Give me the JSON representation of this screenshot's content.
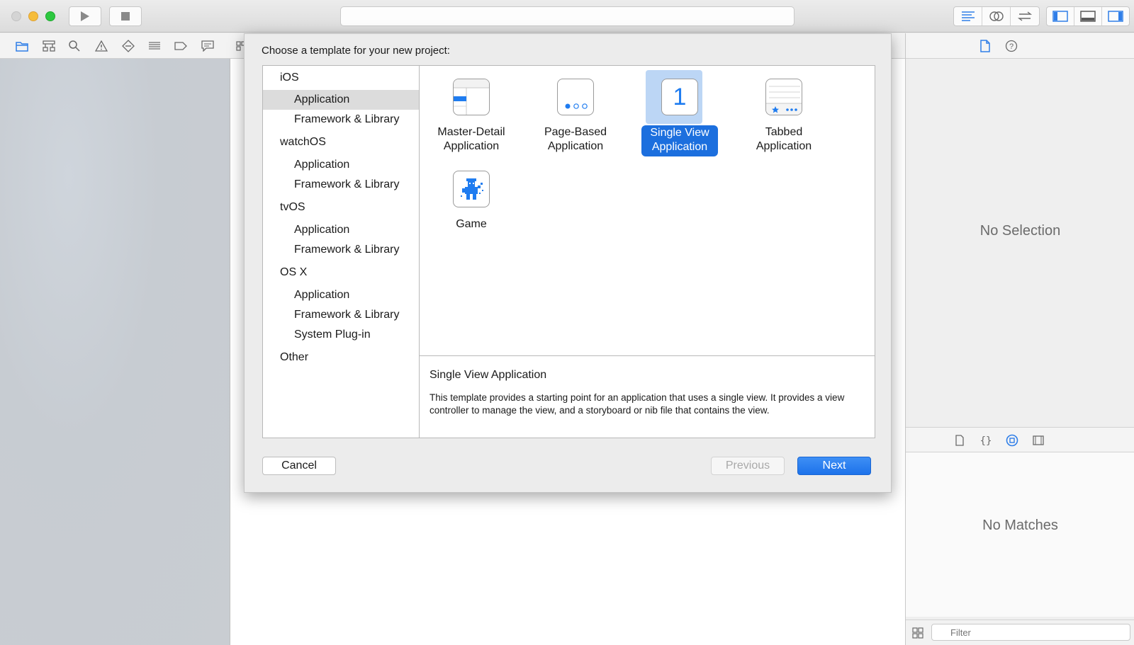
{
  "sheet": {
    "title": "Choose a template for your new project:",
    "categories": [
      {
        "label": "iOS",
        "kind": "heading"
      },
      {
        "label": "Application",
        "kind": "sub",
        "selected": true
      },
      {
        "label": "Framework & Library",
        "kind": "sub"
      },
      {
        "label": "watchOS",
        "kind": "heading"
      },
      {
        "label": "Application",
        "kind": "sub"
      },
      {
        "label": "Framework & Library",
        "kind": "sub"
      },
      {
        "label": "tvOS",
        "kind": "heading"
      },
      {
        "label": "Application",
        "kind": "sub"
      },
      {
        "label": "Framework & Library",
        "kind": "sub"
      },
      {
        "label": "OS X",
        "kind": "heading"
      },
      {
        "label": "Application",
        "kind": "sub"
      },
      {
        "label": "Framework & Library",
        "kind": "sub"
      },
      {
        "label": "System Plug-in",
        "kind": "sub"
      },
      {
        "label": "Other",
        "kind": "heading"
      }
    ],
    "templates": [
      {
        "line1": "Master-Detail",
        "line2": "Application",
        "icon": "master-detail-icon"
      },
      {
        "line1": "Page-Based",
        "line2": "Application",
        "icon": "page-based-icon"
      },
      {
        "line1": "Single View",
        "line2": "Application",
        "icon": "single-view-icon",
        "glyph": "1",
        "selected": true
      },
      {
        "line1": "Tabbed",
        "line2": "Application",
        "icon": "tabbed-icon"
      },
      {
        "line1": "Game",
        "line2": "",
        "icon": "game-icon"
      }
    ],
    "description": {
      "title": "Single View Application",
      "text": "This template provides a starting point for an application that uses a single view. It provides a view controller to manage the view, and a storyboard or nib file that contains the view."
    },
    "buttons": {
      "cancel": "Cancel",
      "previous": "Previous",
      "next": "Next"
    }
  },
  "inspector": {
    "no_selection": "No Selection",
    "no_matches": "No Matches",
    "filter_placeholder": "Filter"
  },
  "colors": {
    "accent": "#1c6fde",
    "icon_blue": "#1f7cf0",
    "selection_halo": "#bcd6f5"
  }
}
